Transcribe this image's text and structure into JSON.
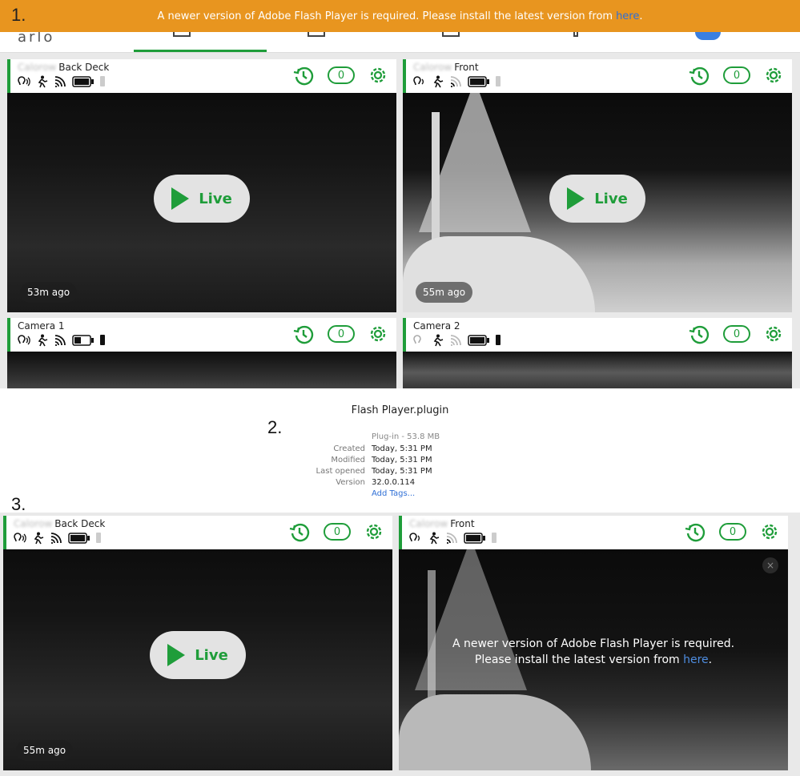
{
  "steps": {
    "one": "1.",
    "two": "2.",
    "three": "3."
  },
  "flash_banner": {
    "text": "A newer version of Adobe Flash Player is required. Please install the latest version from",
    "link": "here",
    "end": "."
  },
  "nav": {
    "logo": "arlo"
  },
  "cameras": [
    {
      "name_blur": "Calorow",
      "name": "Back Deck",
      "count": "0",
      "live": "Live",
      "ago": "53m ago"
    },
    {
      "name_blur": "Calorow",
      "name": "Front",
      "count": "0",
      "live": "Live",
      "ago": "55m ago"
    },
    {
      "name_blur": "",
      "name": "Camera 1",
      "count": "0"
    },
    {
      "name_blur": "",
      "name": "Camera 2",
      "count": "0"
    }
  ],
  "plugin": {
    "title": "Flash Player.plugin",
    "kind": "Plug-in - 53.8 MB",
    "rows": [
      {
        "label": "Created",
        "value": "Today, 5:31 PM"
      },
      {
        "label": "Modified",
        "value": "Today, 5:31 PM"
      },
      {
        "label": "Last opened",
        "value": "Today, 5:31 PM"
      },
      {
        "label": "Version",
        "value": "32.0.0.114"
      }
    ],
    "add_tags": "Add Tags..."
  },
  "cameras_after": [
    {
      "name_blur": "Calorow",
      "name": "Back Deck",
      "count": "0",
      "live": "Live",
      "ago": "55m ago"
    },
    {
      "name_blur": "Calorow",
      "name": "Front",
      "count": "0",
      "msg_line1": "A newer version of Adobe Flash Player is required.",
      "msg_line2_pre": "Please install the latest version from",
      "msg_link": "here",
      "msg_end": ".",
      "close": "×"
    }
  ],
  "colors": {
    "accent": "#1f9d3a",
    "banner": "#e8951f",
    "link": "#2f6fd6"
  }
}
